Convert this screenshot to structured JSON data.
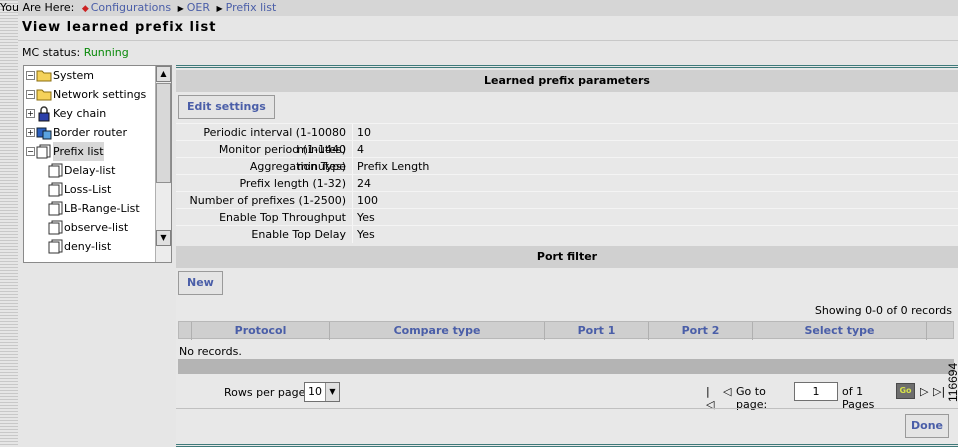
{
  "breadcrumb": {
    "label": "You Are Here:",
    "items": [
      "Configurations",
      "OER",
      "Prefix list"
    ]
  },
  "page_title": "View learned prefix list",
  "mc_status": {
    "label": "MC status:",
    "value": "Running"
  },
  "tree": {
    "items": [
      {
        "label": "System",
        "icon": "folder-icon",
        "toggle": "minus"
      },
      {
        "label": "Network settings",
        "icon": "folder-icon",
        "toggle": "minus"
      },
      {
        "label": "Key chain",
        "icon": "lock-icon",
        "toggle": "plus"
      },
      {
        "label": "Border router",
        "icon": "router-icon",
        "toggle": "plus"
      },
      {
        "label": "Prefix list",
        "icon": "document-icon",
        "toggle": "minus",
        "selected": true
      },
      {
        "label": "Delay-list",
        "icon": "document-icon"
      },
      {
        "label": "Loss-List",
        "icon": "document-icon"
      },
      {
        "label": "LB-Range-List",
        "icon": "document-icon"
      },
      {
        "label": "observe-list",
        "icon": "document-icon"
      },
      {
        "label": "deny-list",
        "icon": "document-icon"
      }
    ]
  },
  "params": {
    "header": "Learned prefix parameters",
    "edit_button": "Edit settings",
    "rows": [
      {
        "label": "Periodic interval (1-10080 minutes)",
        "value": "10"
      },
      {
        "label": "Monitor period (1-1440 minutes)",
        "value": "4"
      },
      {
        "label": "Aggregation Type",
        "value": "Prefix Length"
      },
      {
        "label": "Prefix length (1-32)",
        "value": "24"
      },
      {
        "label": "Number of prefixes (1-2500)",
        "value": "100"
      },
      {
        "label": "Enable Top Throughput",
        "value": "Yes"
      },
      {
        "label": "Enable Top Delay",
        "value": "Yes"
      }
    ]
  },
  "port_filter": {
    "header": "Port filter",
    "new_button": "New",
    "showing": "Showing 0-0 of 0 records",
    "columns": [
      "Protocol",
      "Compare type",
      "Port 1",
      "Port 2",
      "Select type"
    ],
    "no_records": "No records.",
    "rows_per_page_label": "Rows per page:",
    "rows_per_page_value": "10",
    "go_to_label": "Go to page:",
    "page_value": "1",
    "of_pages": "of 1 Pages",
    "go_button": "Go"
  },
  "done_button": "Done",
  "figure_id": "116694",
  "colors": {
    "link": "#4a5ea8",
    "status_ok": "#0a8a0a",
    "accent_rule": "#3f7a7a"
  }
}
